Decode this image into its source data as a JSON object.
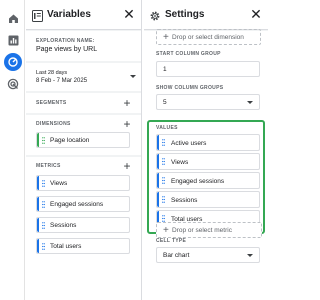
{
  "rail": {
    "icons": [
      "home-icon",
      "reports-icon",
      "explore-icon",
      "advertising-icon"
    ]
  },
  "variables": {
    "title": "Variables",
    "close_label": "✕",
    "exploration_name_label": "EXPLORATION NAME:",
    "exploration_name": "Page views by URL",
    "date_label": "Last 28 days",
    "date_range": "8 Feb - 7 Mar 2025",
    "segments_label": "SEGMENTS",
    "dimensions_label": "DIMENSIONS",
    "dimensions": [
      "Page location"
    ],
    "metrics_label": "METRICS",
    "metrics": [
      "Views",
      "Engaged sessions",
      "Sessions",
      "Total users"
    ],
    "add_label": "+"
  },
  "settings": {
    "title": "Settings",
    "close_label": "✕",
    "drop_dimension": "Drop or select dimension",
    "start_column_group_label": "START COLUMN GROUP",
    "start_column_group": "1",
    "show_column_groups_label": "SHOW COLUMN GROUPS",
    "show_column_groups": "5",
    "values_label": "VALUES",
    "values": [
      "Active users",
      "Views",
      "Engaged sessions",
      "Sessions",
      "Total users"
    ],
    "drop_metric": "Drop or select metric",
    "cell_type_label": "CELL TYPE",
    "cell_type": "Bar chart",
    "drop_plus": "+"
  },
  "colors": {
    "accent": "#1a73e8",
    "highlight": "#34a853",
    "dimension_chip": "#34a853",
    "metric_chip": "#1a73e8"
  }
}
